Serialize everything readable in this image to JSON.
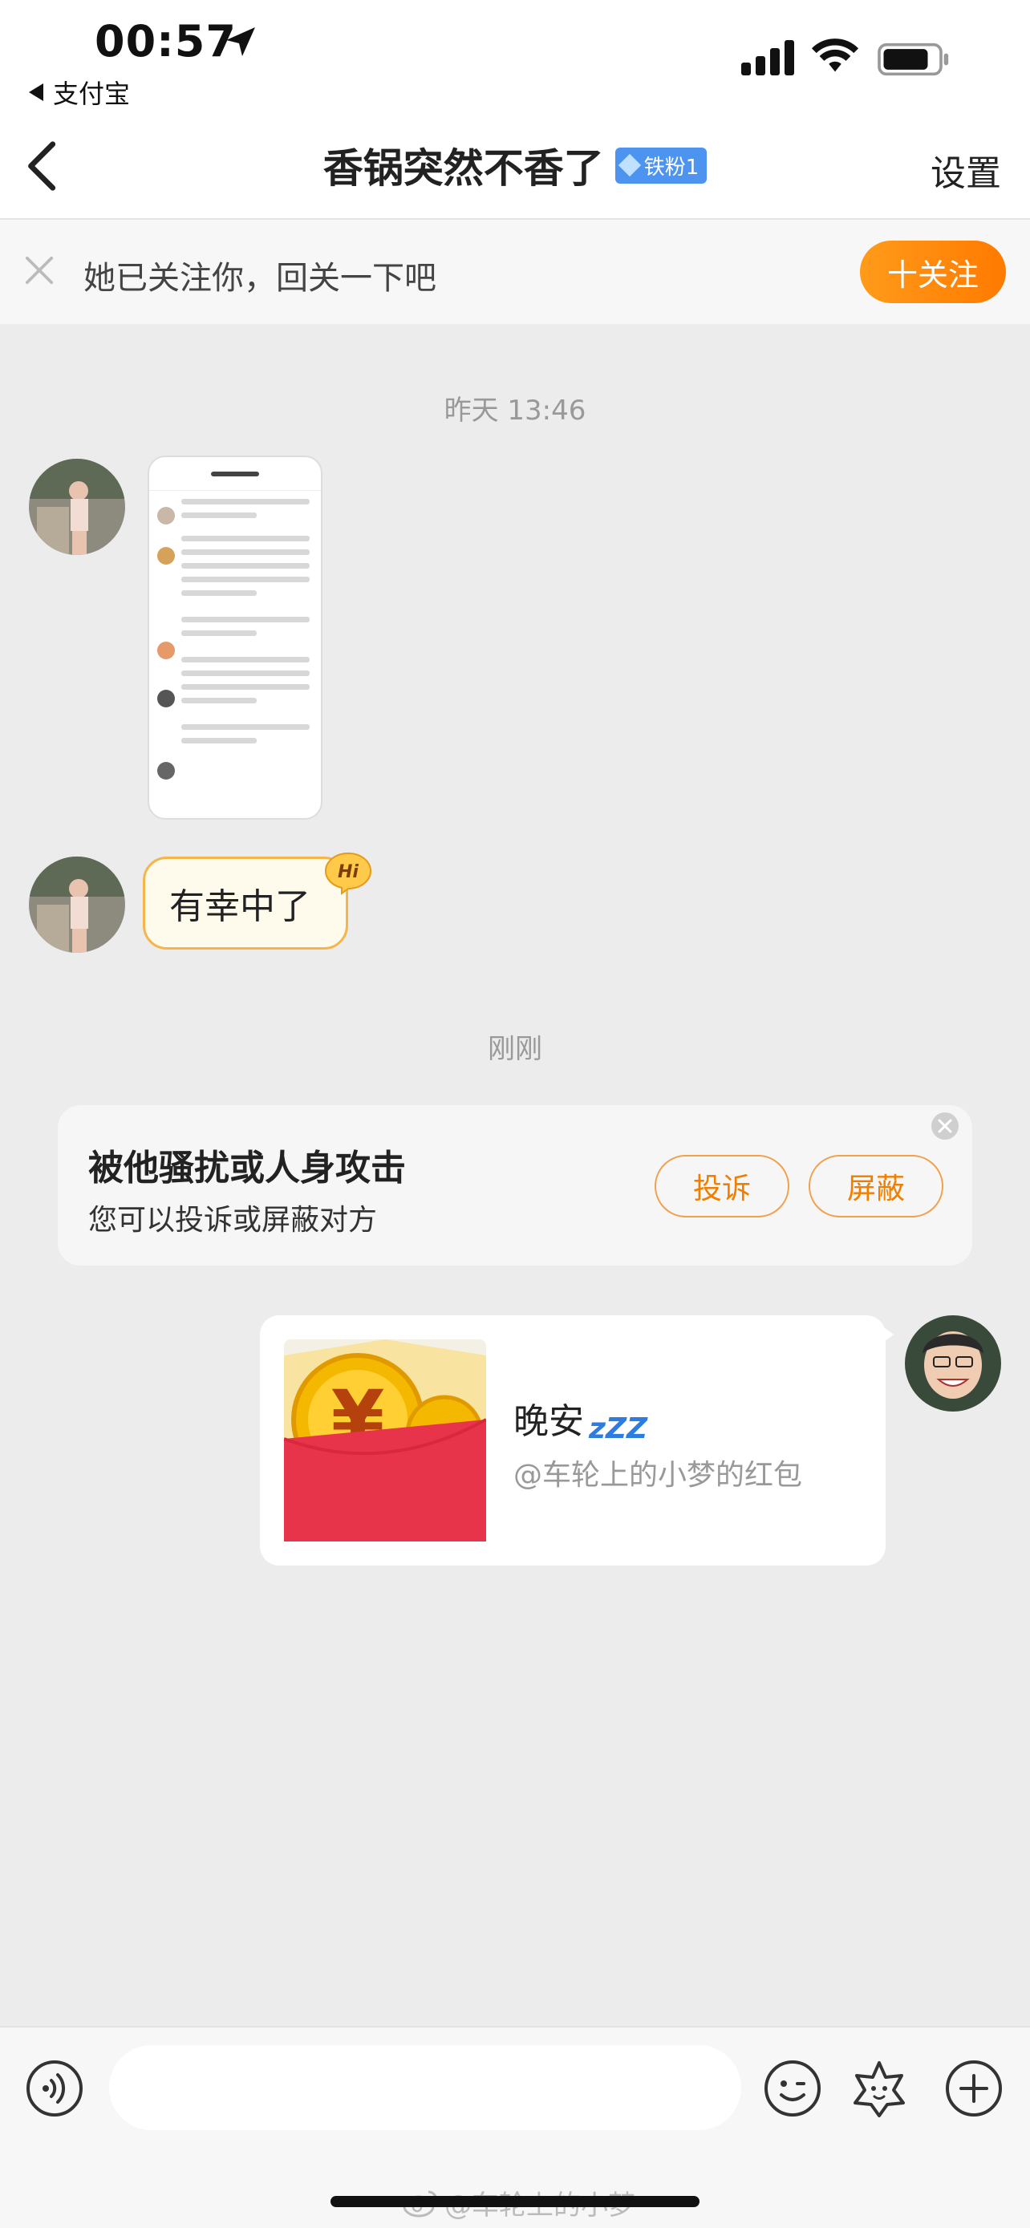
{
  "status_bar": {
    "time": "00:57",
    "back_app": "支付宝",
    "icons": [
      "location-arrow-icon",
      "signal-icon",
      "wifi-icon",
      "battery-icon"
    ]
  },
  "nav": {
    "title": "香锅突然不香了",
    "badge": "铁粉1",
    "settings": "设置",
    "icons": [
      "back-chevron-icon"
    ]
  },
  "follow_banner": {
    "text": "她已关注你，回关一下吧",
    "button": "十关注",
    "icons": [
      "close-icon"
    ]
  },
  "messages": {
    "timestamp_1": "昨天 13:46",
    "text_message": "有幸中了",
    "hi_badge": "Hi",
    "timestamp_2": "刚刚"
  },
  "report_card": {
    "title": "被他骚扰或人身攻击",
    "subtitle": "您可以投诉或屏蔽对方",
    "complain_button": "投诉",
    "block_button": "屏蔽"
  },
  "red_packet": {
    "title": "晚安",
    "zzz": "zZZ",
    "subtitle": "@车轮上的小梦的红包"
  },
  "bottom_bar": {
    "input_placeholder": "",
    "icons": [
      "voice-icon",
      "emoji-icon",
      "sticker-icon",
      "plus-icon"
    ]
  },
  "watermark": "@车轮上的小梦",
  "colors": {
    "accent_orange": "#ff8a00",
    "badge_blue": "#4d93f0",
    "red_packet": "#e8344a",
    "background": "#ececec"
  }
}
